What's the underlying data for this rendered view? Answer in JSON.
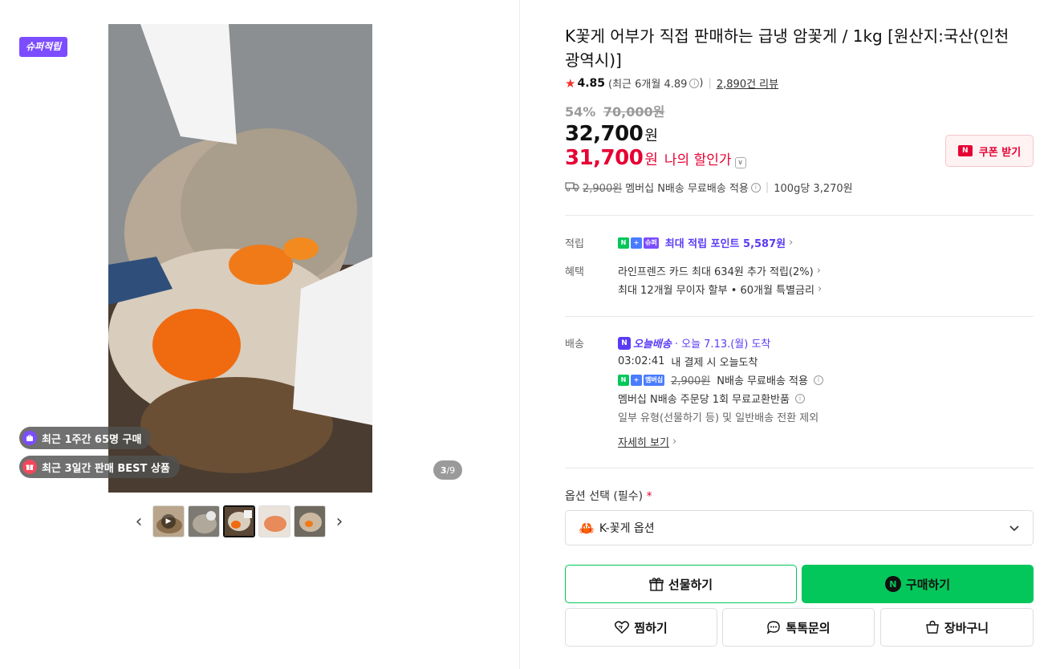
{
  "gallery": {
    "super_badge": "슈퍼적립",
    "social": {
      "weekly_buyers": "최근 1주간 65명 구매",
      "best_seller": "최근 3일간 판매 BEST 상품"
    },
    "counter_current": "3",
    "counter_total": "/9",
    "thumbnails": [
      "video-thumb",
      "thumb-2",
      "thumb-3",
      "thumb-4",
      "thumb-5"
    ],
    "active_thumb_index": 2
  },
  "product": {
    "title": "K꽃게 어부가 직접 판매하는 급냉 암꽃게 / 1kg [원산지:국산(인천광역시)]",
    "rating": {
      "score": "4.85",
      "recent": "(최근 6개월 4.89",
      "recent_close": ")",
      "reviews": "2,890건 리뷰"
    },
    "discount_rate": "54%",
    "original_price": "70,000원",
    "price": "32,700",
    "price_unit": "원",
    "my_price": "31,700",
    "my_price_unit": "원",
    "my_price_label": "나의 할인가",
    "coupon_label": "쿠폰 받기",
    "ship_summary": {
      "fee": "2,900원",
      "text": "멤버십 N배송 무료배송 적용",
      "unit_price": "100g당 3,270원"
    }
  },
  "points": {
    "label": "적립",
    "badges": [
      "N",
      "+",
      "슈퍼"
    ],
    "text": "최대 적립 포인트 5,587원"
  },
  "benefits": {
    "label": "혜택",
    "items": [
      "라인프렌즈 카드 최대 634원 추가 적립(2%)",
      "최대 12개월 무이자 할부 • 60개월 특별금리"
    ]
  },
  "delivery": {
    "label": "배송",
    "today_label": "오늘배송",
    "arrival": "· 오늘 7.13.(월) 도착",
    "countdown": "03:02:41",
    "countdown_text": "내 결제 시 오늘도착",
    "badges": [
      "N",
      "+",
      "멤버십"
    ],
    "fee": "2,900원",
    "fee_text": "N배송 무료배송 적용",
    "exchange": "멤버십 N배송 주문당 1회 무료교환반품",
    "exception": "일부 유형(선물하기 등) 및 일반배송 전환 제외",
    "detail_link": "자세히 보기"
  },
  "options": {
    "label": "옵션 선택 (필수)",
    "required_mark": "*",
    "selected": "K-꽃게 옵션"
  },
  "actions": {
    "gift": "선물하기",
    "buy": "구매하기",
    "wish": "찜하기",
    "talk": "톡톡문의",
    "cart": "장바구니"
  },
  "colors": {
    "naver_green": "#03c75a",
    "discount_red": "#e60033",
    "point_purple": "#5b3bf5",
    "super_purple": "#7c4dff"
  }
}
